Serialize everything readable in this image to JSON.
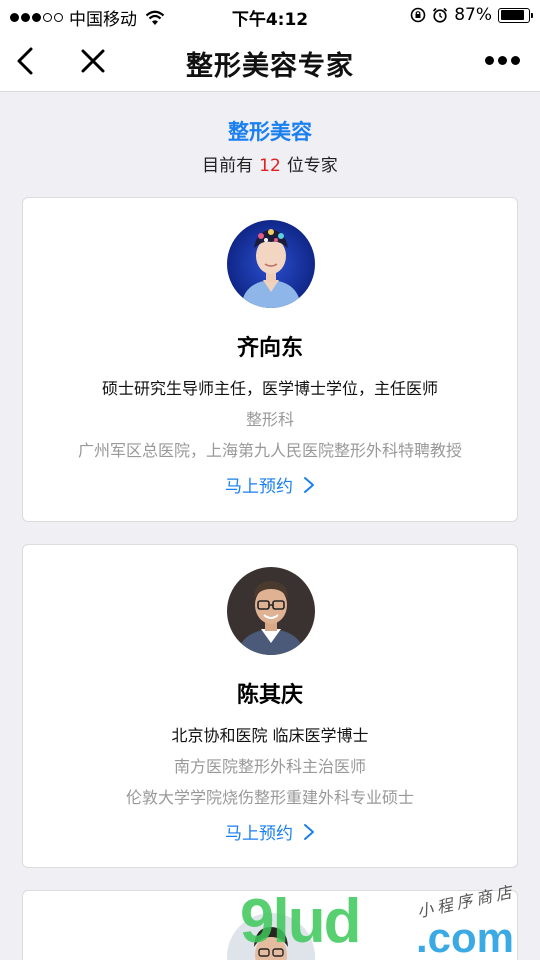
{
  "status_bar": {
    "carrier": "中国移动",
    "time": "下午4:12",
    "battery_text": "87%",
    "battery_level": 0.87
  },
  "nav": {
    "title": "整形美容专家"
  },
  "header": {
    "section_title": "整形美容",
    "count_prefix": "目前有",
    "count": "12",
    "count_suffix": "位专家"
  },
  "doctors": [
    {
      "name": "齐向东",
      "line1": "硕士研究生导师主任，医学博士学位，主任医师",
      "line2": "整形科",
      "line3": "广州军区总医院，上海第九人民医院整形外科特聘教授",
      "book_label": "马上预约"
    },
    {
      "name": "陈其庆",
      "line1": "北京协和医院 临床医学博士",
      "line2": "南方医院整形外科主治医师",
      "line3": "伦敦大学学院烧伤整形重建外科专业硕士",
      "book_label": "马上预约"
    }
  ],
  "watermark": {
    "brand": "9lud",
    "suffix": ".com",
    "tagline": "小程序商店"
  },
  "colors": {
    "accent": "#1a7ff0",
    "count_red": "#e02020",
    "background": "#efeff4"
  }
}
